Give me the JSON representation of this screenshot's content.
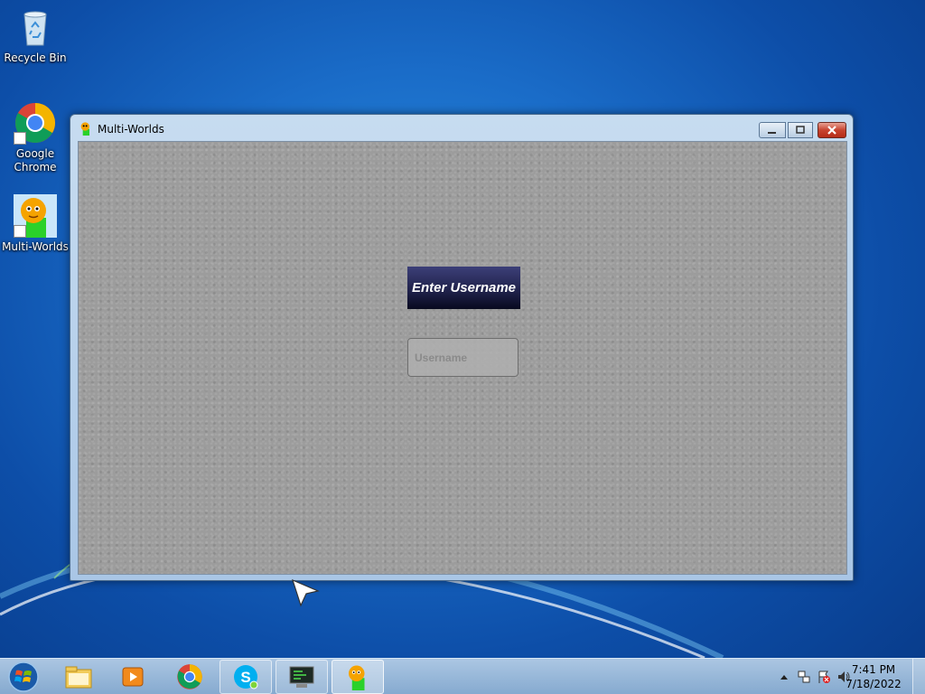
{
  "desktop": {
    "icons": [
      {
        "label": "Recycle Bin",
        "icon": "recycle-bin-icon"
      },
      {
        "label": "Google Chrome",
        "icon": "chrome-icon"
      },
      {
        "label": "Multi-Worlds",
        "icon": "multi-worlds-icon"
      }
    ]
  },
  "window": {
    "title": "Multi-Worlds",
    "heading": "Enter Username",
    "username_placeholder": "Username",
    "username_value": ""
  },
  "taskbar": {
    "items": [
      {
        "icon": "windows-start-icon",
        "label": "Start"
      },
      {
        "icon": "file-explorer-icon",
        "state": "pinned"
      },
      {
        "icon": "media-player-icon",
        "state": "pinned"
      },
      {
        "icon": "chrome-icon",
        "state": "pinned"
      },
      {
        "icon": "skype-icon",
        "state": "open"
      },
      {
        "icon": "terminal-icon",
        "state": "open"
      },
      {
        "icon": "multi-worlds-icon",
        "state": "active"
      }
    ],
    "clock": {
      "time": "7:41 PM",
      "date": "7/18/2022"
    }
  },
  "colors": {
    "desktop": "#1a6cc8",
    "window_frame": "#a9c6e6",
    "client_bg": "#9c9c9c",
    "heading_bg": "#1e2048",
    "close_button": "#c7432f"
  }
}
